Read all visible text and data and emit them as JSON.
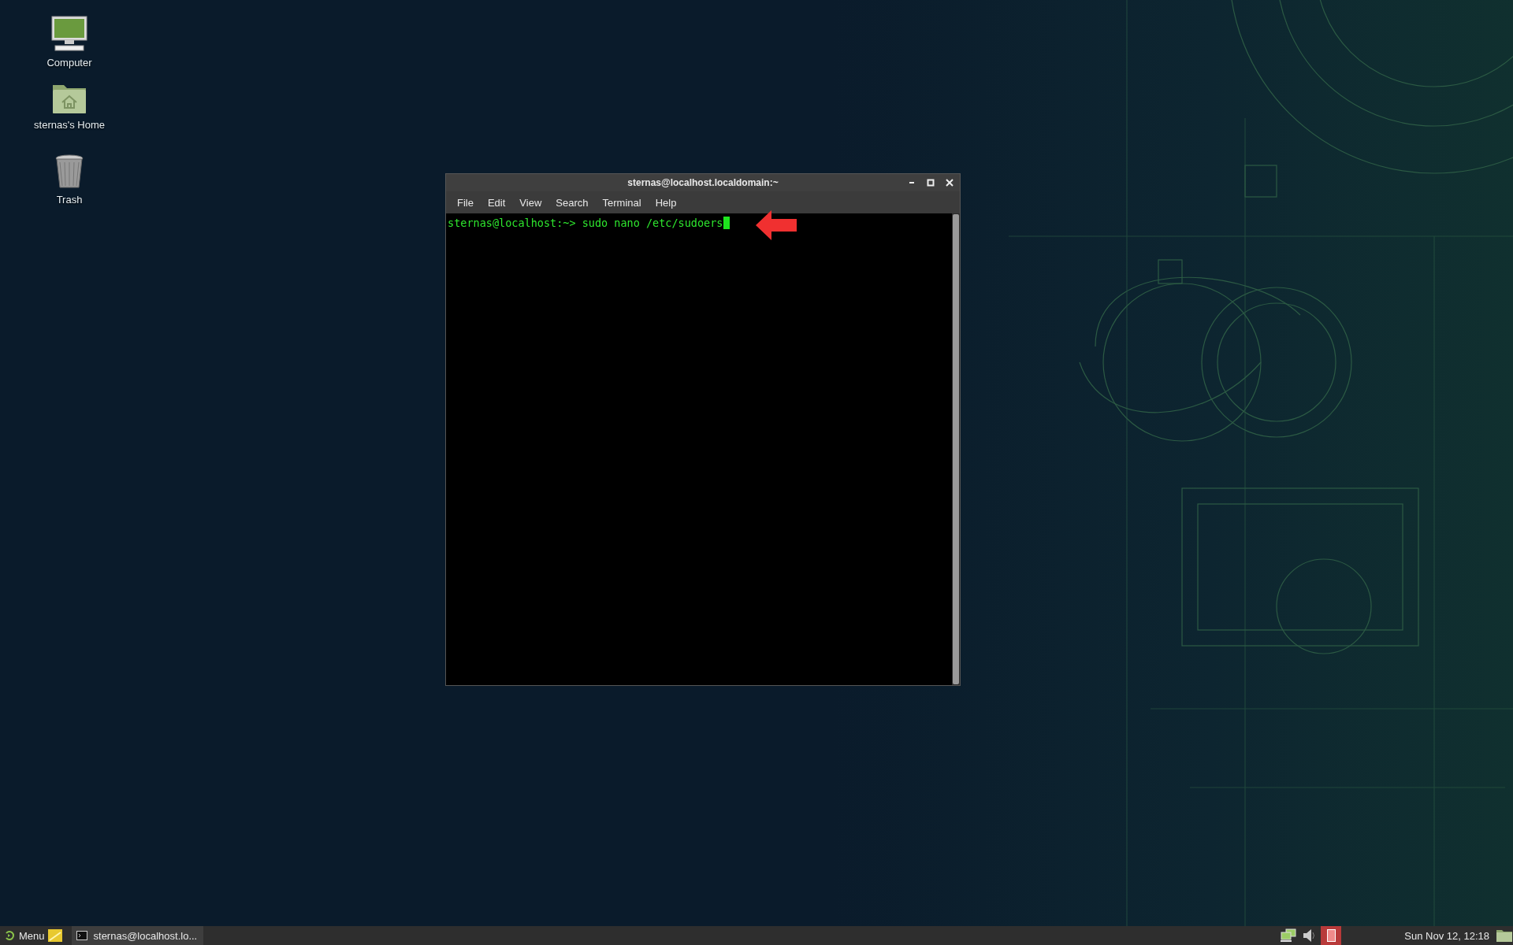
{
  "desktop_icons": [
    {
      "kind": "computer",
      "label": "Computer"
    },
    {
      "kind": "home",
      "label": "sternas's Home"
    },
    {
      "kind": "trash",
      "label": "Trash"
    }
  ],
  "window": {
    "title": "sternas@localhost.localdomain:~",
    "menu": [
      "File",
      "Edit",
      "View",
      "Search",
      "Terminal",
      "Help"
    ],
    "terminal": {
      "prompt": "sternas@localhost:~>",
      "command": "sudo nano /etc/sudoers"
    }
  },
  "taskbar": {
    "menu_label": "Menu",
    "tasks": [
      {
        "label": "sternas@localhost.lo...",
        "selected": true
      }
    ],
    "clock": "Sun Nov 12, 12:18"
  }
}
